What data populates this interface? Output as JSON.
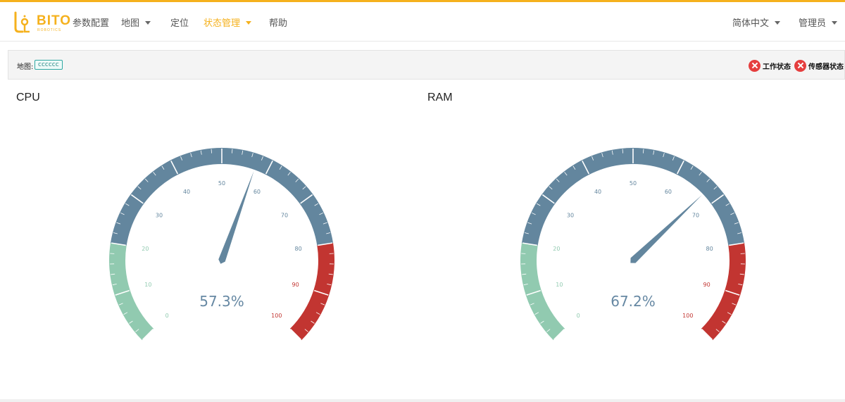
{
  "brand": {
    "name": "BITO",
    "sub": "ROBOTICS",
    "color": "#f5b11d"
  },
  "nav": {
    "items": [
      {
        "label": "参数配置",
        "has_dropdown": false,
        "active": false
      },
      {
        "label": "地图",
        "has_dropdown": true,
        "active": false
      },
      {
        "label": "定位",
        "has_dropdown": false,
        "active": false
      },
      {
        "label": "状态管理",
        "has_dropdown": true,
        "active": true
      },
      {
        "label": "帮助",
        "has_dropdown": false,
        "active": false
      }
    ],
    "language": "简体中文",
    "user": "管理员"
  },
  "status_bar": {
    "map_label": "地图:",
    "map_name": "cccccc",
    "indicators": [
      {
        "label": "工作状态",
        "icon": "error-x-icon",
        "state": "error"
      },
      {
        "label": "传感器状态",
        "icon": "error-x-icon",
        "state": "error"
      }
    ]
  },
  "gauges": [
    {
      "title": "CPU",
      "value": 57.3,
      "display": "57.3%",
      "min": 0,
      "max": 100
    },
    {
      "title": "RAM",
      "value": 67.2,
      "display": "67.2%",
      "min": 0,
      "max": 100
    }
  ],
  "gauge_style": {
    "ticks": [
      "0",
      "10",
      "20",
      "30",
      "40",
      "50",
      "60",
      "70",
      "80",
      "90",
      "100"
    ],
    "bands": [
      {
        "from": 0,
        "to": 20,
        "color": "#91cab0"
      },
      {
        "from": 20,
        "to": 80,
        "color": "#63869e"
      },
      {
        "from": 80,
        "to": 100,
        "color": "#c23531"
      }
    ],
    "pointer_color": "#63869e"
  }
}
